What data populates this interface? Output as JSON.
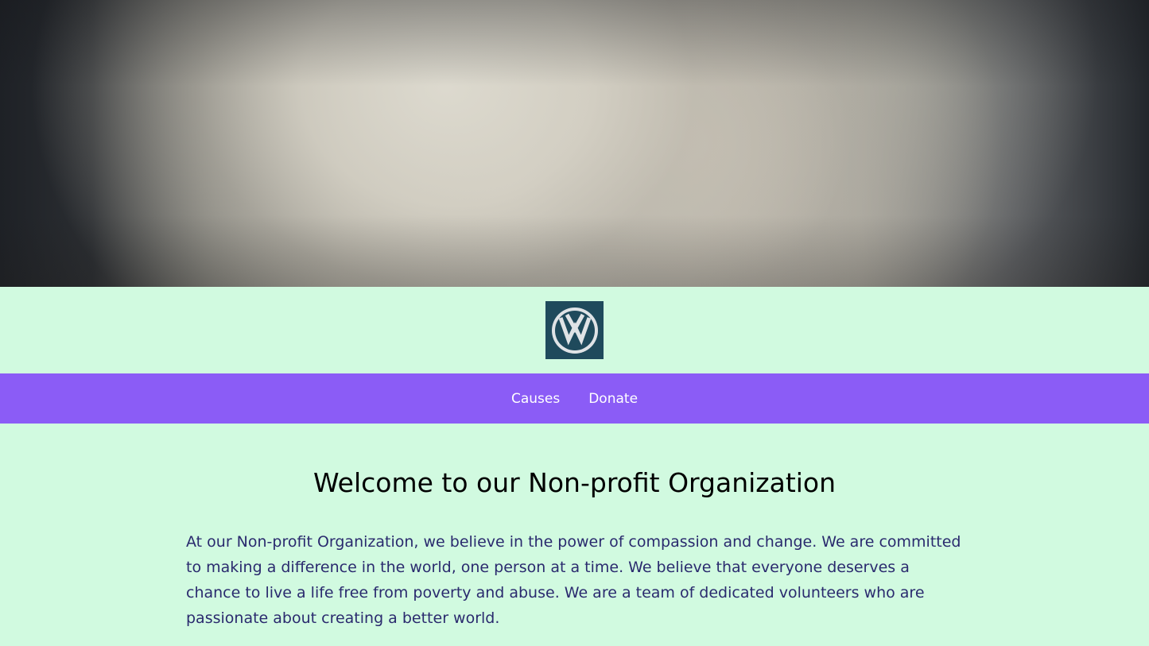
{
  "logo": {
    "icon": "vw-logo-icon",
    "background_color": "#1f4a5c"
  },
  "nav": {
    "background_color": "#8b5cf6",
    "items": [
      {
        "label": "Causes"
      },
      {
        "label": "Donate"
      }
    ]
  },
  "main": {
    "title": "Welcome to our Non-profit Organization",
    "intro": "At our Non-profit Organization, we believe in the power of compassion and change. We are committed to making a difference in the world, one person at a time. We believe that everyone deserves a chance to live a life free from poverty and abuse. We are a team of dedicated volunteers who are passionate about creating a better world."
  },
  "colors": {
    "page_background": "#d1fae0",
    "body_text": "#2a2a6e"
  }
}
